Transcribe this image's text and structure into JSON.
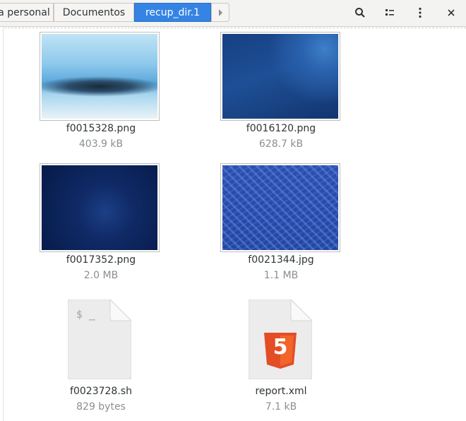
{
  "breadcrumbs": [
    {
      "label": "a personal"
    },
    {
      "label": "Documentos"
    },
    {
      "label": "recup_dir.1"
    }
  ],
  "toolbar": {
    "search_icon": "search-icon",
    "view_icon": "view-options-icon",
    "menu_icon": "kebab-menu-icon",
    "close_icon": "close-icon"
  },
  "files": [
    {
      "name": "f0015328.png",
      "size": "403.9 kB",
      "type": "image"
    },
    {
      "name": "f0016120.png",
      "size": "628.7 kB",
      "type": "image"
    },
    {
      "name": "f0017352.png",
      "size": "2.0 MB",
      "type": "image"
    },
    {
      "name": "f0021344.jpg",
      "size": "1.1 MB",
      "type": "image"
    },
    {
      "name": "f0023728.sh",
      "size": "829 bytes",
      "type": "script",
      "glyph": "$ _"
    },
    {
      "name": "report.xml",
      "size": "7.1 kB",
      "type": "html",
      "glyph": "5"
    }
  ],
  "colors": {
    "accent": "#3584e4",
    "html5": "#e44d26"
  }
}
